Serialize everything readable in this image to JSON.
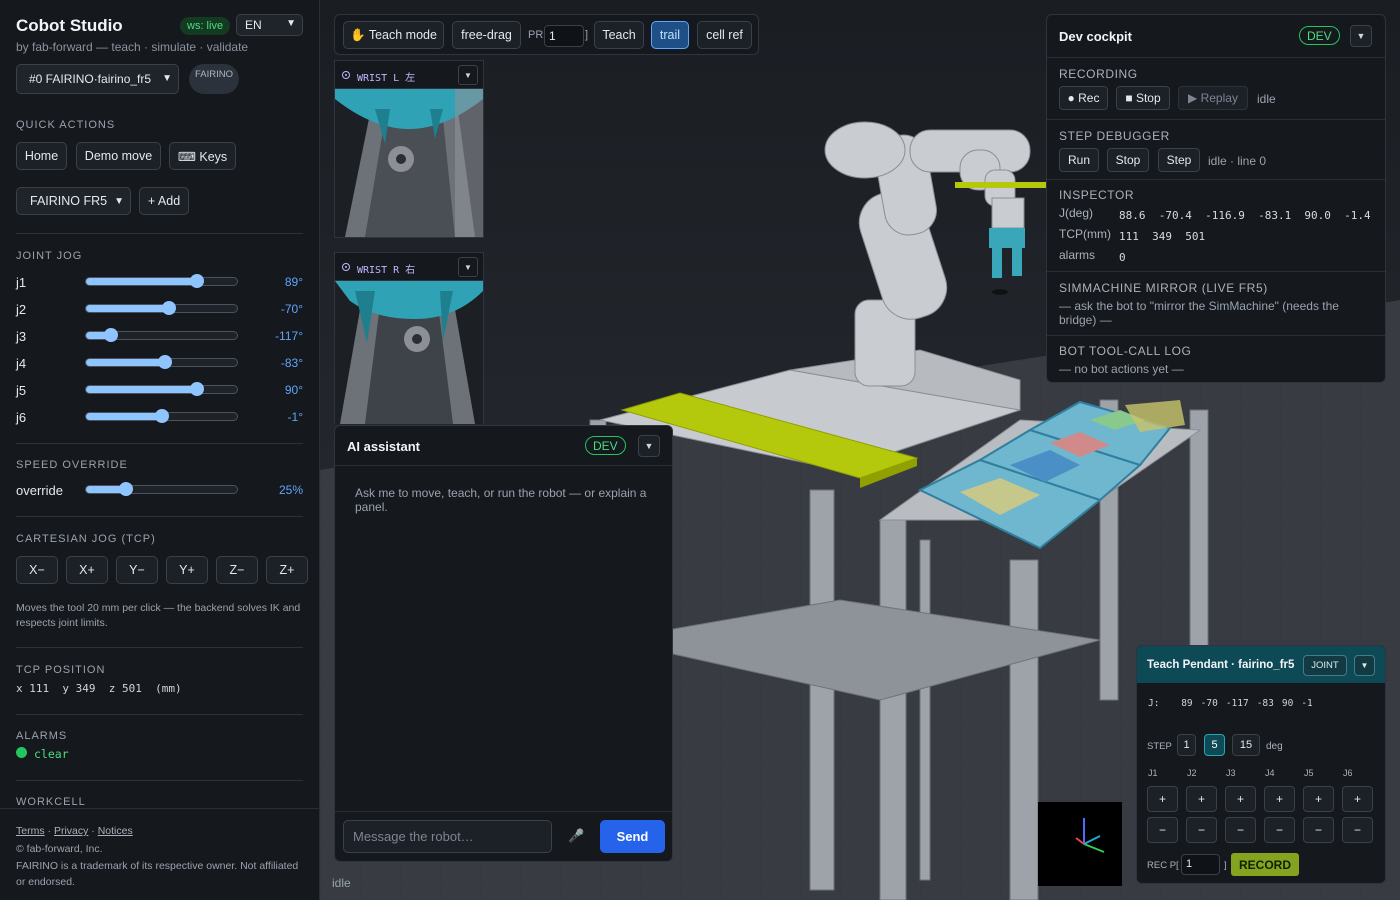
{
  "app": {
    "title": "Cobot Studio",
    "subtitle": "by fab-forward — teach · simulate · validate",
    "ws_status": "ws: live",
    "language": "EN",
    "robot_select": "#0 FAIRINO·fairino_fr5",
    "brand_pill": "FAIRINO"
  },
  "quick_actions": {
    "heading": "QUICK ACTIONS",
    "home": "Home",
    "demo": "Demo move",
    "keys": "⌨ Keys",
    "model_select": "FAIRINO FR5",
    "add": "+ Add"
  },
  "joint_jog": {
    "heading": "JOINT JOG",
    "joints": [
      {
        "label": "j1",
        "value": "89°",
        "level": 0.73
      },
      {
        "label": "j2",
        "value": "-70°",
        "level": 0.55
      },
      {
        "label": "j3",
        "value": "-117°",
        "level": 0.17
      },
      {
        "label": "j4",
        "value": "-83°",
        "level": 0.52
      },
      {
        "label": "j5",
        "value": "90°",
        "level": 0.73
      },
      {
        "label": "j6",
        "value": "-1°",
        "level": 0.5
      }
    ]
  },
  "speed": {
    "heading": "SPEED OVERRIDE",
    "label": "override",
    "value": "25%",
    "level": 0.27
  },
  "cartesian": {
    "heading": "CARTESIAN JOG (TCP)",
    "buttons": [
      "X−",
      "X+",
      "Y−",
      "Y+",
      "Z−",
      "Z+"
    ],
    "note": "Moves the tool 20 mm per click — the backend solves IK and respects joint limits."
  },
  "tcp": {
    "heading": "TCP POSITION",
    "readout": "x 111  y 349  z 501  (mm)"
  },
  "alarms": {
    "heading": "ALARMS",
    "status": "clear"
  },
  "workcell": {
    "heading": "WORKCELL"
  },
  "footer": {
    "terms": "Terms",
    "privacy": "Privacy",
    "notices": "Notices",
    "copyright": "© fab-forward, Inc.",
    "trademark": "FAIRINO is a trademark of its respective owner. Not affiliated or endorsed."
  },
  "toolbar": {
    "teach_mode": "✋ Teach mode",
    "free_drag": "free-drag",
    "pr_label": "PR[",
    "pr_value": "1",
    "pr_close": "]",
    "teach": "Teach",
    "trail": "trail",
    "cell_ref": "cell ref"
  },
  "cams": {
    "left": "WRIST L 左",
    "right": "WRIST R 右"
  },
  "assistant": {
    "title": "AI assistant",
    "badge": "DEV",
    "hint": "Ask me to move, teach, or run the robot — or explain a panel.",
    "placeholder": "Message the robot…",
    "send": "Send"
  },
  "status": "idle",
  "cockpit": {
    "title": "Dev cockpit",
    "badge": "DEV",
    "recording": {
      "heading": "RECORDING",
      "rec": "● Rec",
      "stop": "■ Stop",
      "replay": "▶ Replay",
      "state": "idle"
    },
    "debugger": {
      "heading": "STEP DEBUGGER",
      "run": "Run",
      "stop": "Stop",
      "step": "Step",
      "state": "idle · line 0"
    },
    "inspector": {
      "heading": "INSPECTOR",
      "j_label": "J(deg)",
      "j_value": "88.6  -70.4  -116.9  -83.1  90.0  -1.4",
      "tcp_label": "TCP(mm)",
      "tcp_value": "111  349  501",
      "alarms_label": "alarms",
      "alarms_value": "0"
    },
    "mirror": {
      "heading": "SIMMACHINE MIRROR (LIVE FR5)",
      "text": "— ask the bot to \"mirror the SimMachine\" (needs the bridge) —"
    },
    "toolcall": {
      "heading": "BOT TOOL-CALL LOG",
      "text": "— no bot actions yet —"
    }
  },
  "pendant": {
    "title": "Teach Pendant · fairino_fr5",
    "mode": "JOINT",
    "j_label": "J:",
    "j_values": [
      "89",
      "-70",
      "-117",
      "-83",
      "90",
      "-1"
    ],
    "step_label": "STEP",
    "steps": [
      "1",
      "5",
      "15"
    ],
    "step_active": "5",
    "step_unit": "deg",
    "joint_heads": [
      "J1",
      "J2",
      "J3",
      "J4",
      "J5",
      "J6"
    ],
    "plus": "+",
    "minus": "−",
    "rec_label": "REC P[",
    "rec_value": "1",
    "rec_close": "]",
    "record": "RECORD"
  }
}
